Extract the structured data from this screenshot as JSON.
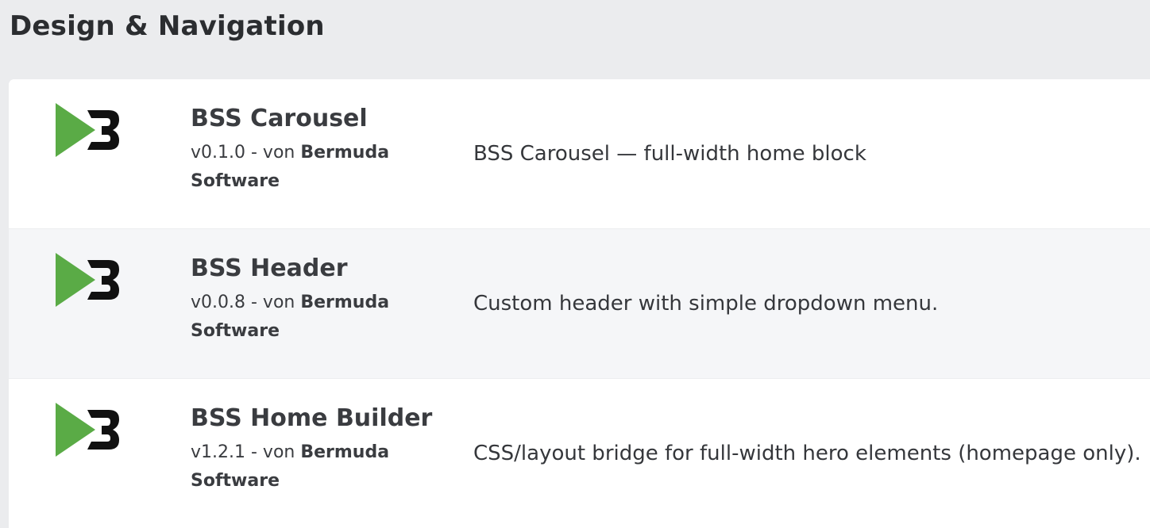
{
  "section": {
    "title": "Design & Navigation"
  },
  "plugins": [
    {
      "name": "BSS Carousel",
      "version": "v0.1.0",
      "by": " - von ",
      "author": "Bermuda Software",
      "description": "BSS Carousel — full-width home block",
      "icon": "bermuda-b3-logo-icon"
    },
    {
      "name": "BSS Header",
      "version": "v0.0.8",
      "by": " - von ",
      "author": "Bermuda Software",
      "description": "Custom header with simple dropdown menu.",
      "icon": "bermuda-b3-logo-icon"
    },
    {
      "name": "BSS Home Builder",
      "version": "v1.2.1",
      "by": " - von ",
      "author": "Bermuda Software",
      "description": "CSS/layout bridge for full-width hero elements (homepage only).",
      "icon": "bermuda-b3-logo-icon"
    }
  ],
  "colors": {
    "logo_green": "#5aab46",
    "logo_black": "#111111",
    "page_background": "#ebecee",
    "row_alt_background": "#f5f6f8"
  }
}
